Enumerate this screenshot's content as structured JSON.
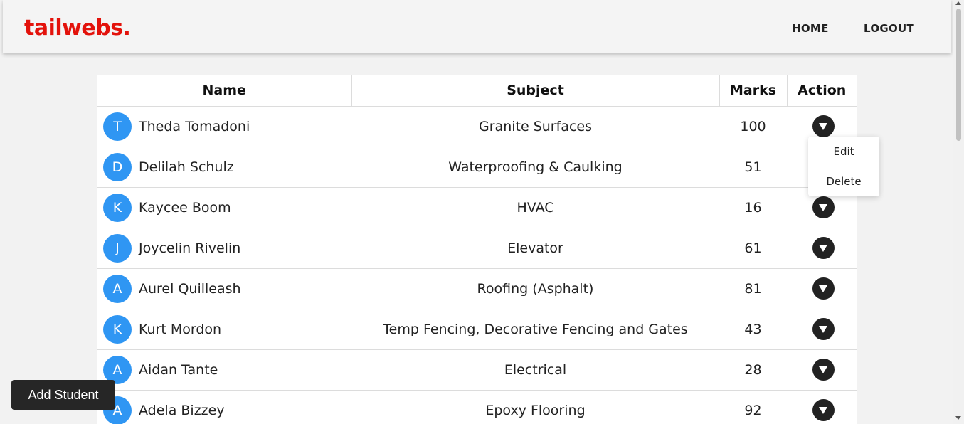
{
  "header": {
    "logo": "tailwebs.",
    "logo_color": "#e3120b",
    "nav": {
      "home": "HOME",
      "logout": "LOGOUT"
    }
  },
  "table": {
    "columns": [
      "Name",
      "Subject",
      "Marks",
      "Action"
    ],
    "rows": [
      {
        "initial": "T",
        "name": "Theda Tomadoni",
        "subject": "Granite Surfaces",
        "marks": "100"
      },
      {
        "initial": "D",
        "name": "Delilah Schulz",
        "subject": "Waterproofing & Caulking",
        "marks": "51"
      },
      {
        "initial": "K",
        "name": "Kaycee Boom",
        "subject": "HVAC",
        "marks": "16"
      },
      {
        "initial": "J",
        "name": "Joycelin Rivelin",
        "subject": "Elevator",
        "marks": "61"
      },
      {
        "initial": "A",
        "name": "Aurel Quilleash",
        "subject": "Roofing (Asphalt)",
        "marks": "81"
      },
      {
        "initial": "K",
        "name": "Kurt Mordon",
        "subject": "Temp Fencing, Decorative Fencing and Gates",
        "marks": "43"
      },
      {
        "initial": "A",
        "name": "Aidan Tante",
        "subject": "Electrical",
        "marks": "28"
      },
      {
        "initial": "A",
        "name": "Adela Bizzey",
        "subject": "Epoxy Flooring",
        "marks": "92"
      }
    ],
    "avatar_color": "#2f96f3",
    "action_icon": "caret-down-icon"
  },
  "dropdown": {
    "edit": "Edit",
    "delete": "Delete"
  },
  "add_student": "Add Student"
}
